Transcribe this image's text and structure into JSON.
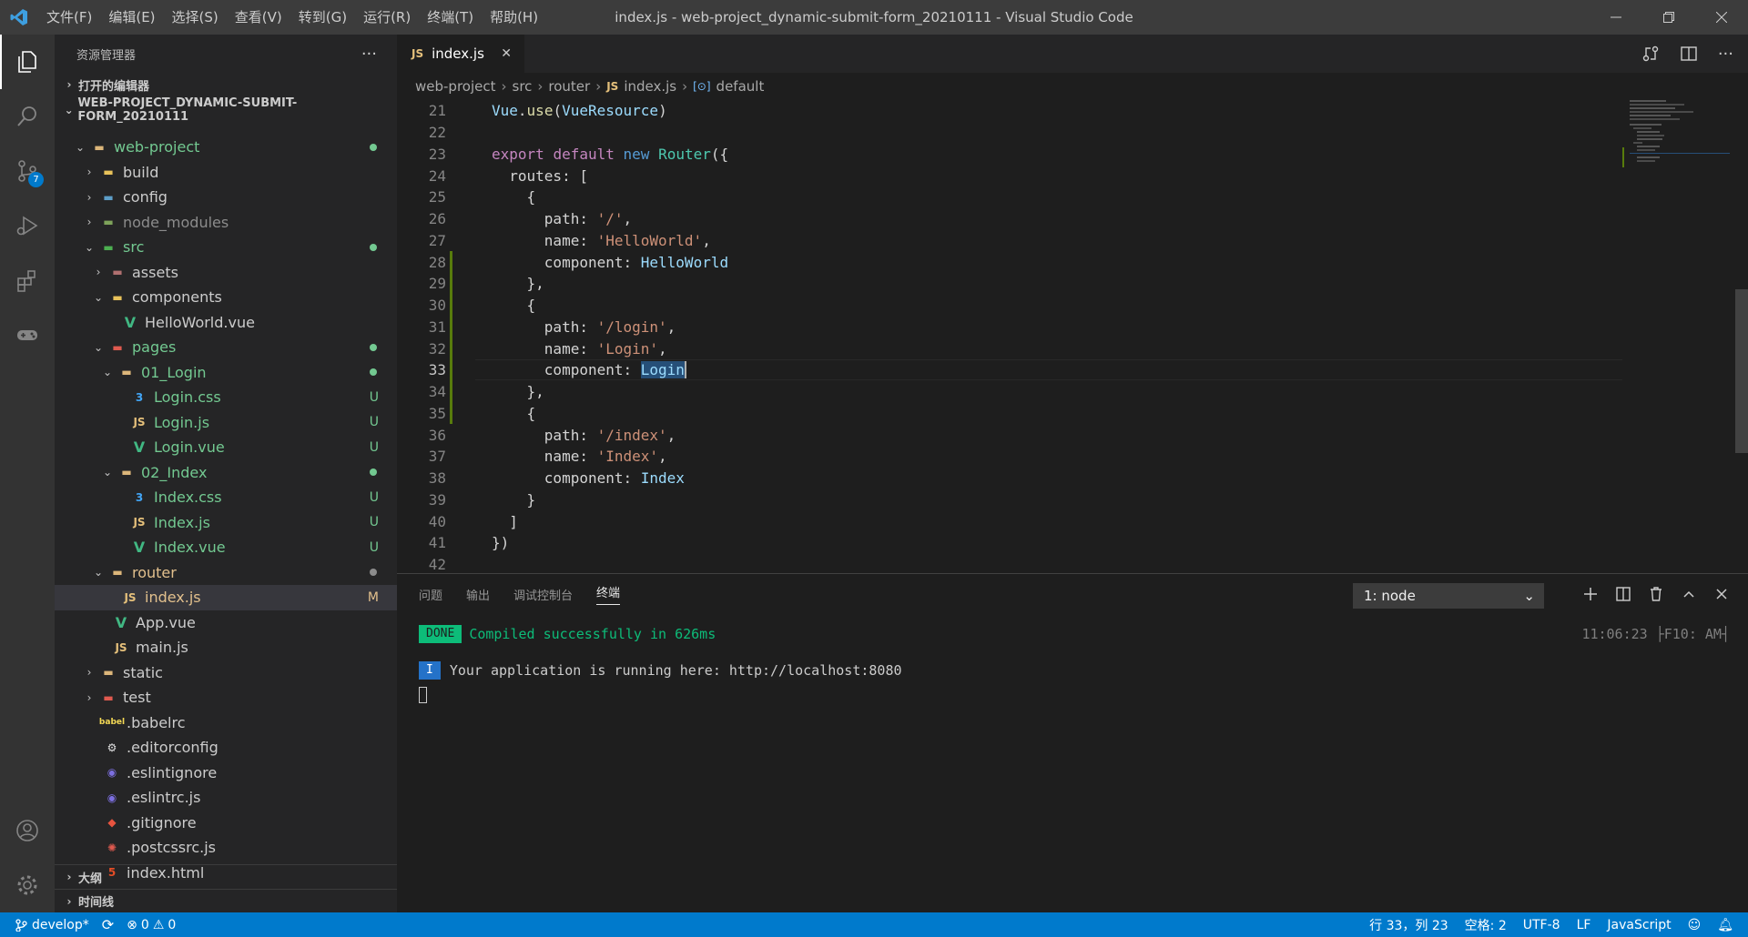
{
  "window": {
    "title": "index.js - web-project_dynamic-submit-form_20210111 - Visual Studio Code",
    "menu": [
      "文件(F)",
      "编辑(E)",
      "选择(S)",
      "查看(V)",
      "转到(G)",
      "运行(R)",
      "终端(T)",
      "帮助(H)"
    ]
  },
  "activity": {
    "scm_badge": "7"
  },
  "sidebar": {
    "header": "资源管理器",
    "open_editors": "打开的编辑器",
    "project": "WEB-PROJECT_DYNAMIC-SUBMIT-FORM_20210111",
    "tree": [
      {
        "label": "web-project",
        "decor": "dot"
      },
      {
        "label": "build"
      },
      {
        "label": "config"
      },
      {
        "label": "node_modules"
      },
      {
        "label": "src",
        "decor": "dot"
      },
      {
        "label": "assets"
      },
      {
        "label": "components"
      },
      {
        "label": "HelloWorld.vue"
      },
      {
        "label": "pages",
        "decor": "dot"
      },
      {
        "label": "01_Login",
        "decor": "dot"
      },
      {
        "label": "Login.css",
        "decor": "U"
      },
      {
        "label": "Login.js",
        "decor": "U"
      },
      {
        "label": "Login.vue",
        "decor": "U"
      },
      {
        "label": "02_Index",
        "decor": "dot"
      },
      {
        "label": "Index.css",
        "decor": "U"
      },
      {
        "label": "Index.js",
        "decor": "U"
      },
      {
        "label": "Index.vue",
        "decor": "U"
      },
      {
        "label": "router",
        "decor": "dot"
      },
      {
        "label": "index.js",
        "decor": "M"
      },
      {
        "label": "App.vue"
      },
      {
        "label": "main.js"
      },
      {
        "label": "static"
      },
      {
        "label": "test"
      },
      {
        "label": ".babelrc"
      },
      {
        "label": ".editorconfig"
      },
      {
        "label": ".eslintignore"
      },
      {
        "label": ".eslintrc.js"
      },
      {
        "label": ".gitignore"
      },
      {
        "label": ".postcssrc.js"
      },
      {
        "label": "index.html"
      }
    ],
    "outline": "大纲",
    "timeline": "时间线"
  },
  "editor": {
    "tab_label": "index.js",
    "tab_badge": "JS",
    "breadcrumb": [
      "web-project",
      "src",
      "router",
      "index.js",
      "default"
    ],
    "lines": [
      {
        "n": "21",
        "code": "Vue.use(VueResource)"
      },
      {
        "n": "22",
        "code": ""
      },
      {
        "n": "23",
        "code": "export default new Router({"
      },
      {
        "n": "24",
        "code": "  routes: ["
      },
      {
        "n": "25",
        "code": "    {"
      },
      {
        "n": "26",
        "code": "      path: '/',"
      },
      {
        "n": "27",
        "code": "      name: 'HelloWorld',"
      },
      {
        "n": "28",
        "code": "      component: HelloWorld"
      },
      {
        "n": "29",
        "code": "    },"
      },
      {
        "n": "30",
        "code": "    {"
      },
      {
        "n": "31",
        "code": "      path: '/login',"
      },
      {
        "n": "32",
        "code": "      name: 'Login',"
      },
      {
        "n": "33",
        "code": "      component: Login"
      },
      {
        "n": "34",
        "code": "    },"
      },
      {
        "n": "35",
        "code": "    {"
      },
      {
        "n": "36",
        "code": "      path: '/index',"
      },
      {
        "n": "37",
        "code": "      name: 'Index',"
      },
      {
        "n": "38",
        "code": "      component: Index"
      },
      {
        "n": "39",
        "code": "    }"
      },
      {
        "n": "40",
        "code": "  ]"
      },
      {
        "n": "41",
        "code": "})"
      },
      {
        "n": "42",
        "code": ""
      }
    ]
  },
  "panel": {
    "tabs": [
      "问题",
      "输出",
      "调试控制台",
      "终端"
    ],
    "terminal_select": "1: node",
    "done_badge": "DONE",
    "done_text": "Compiled successfully in 626ms",
    "time": "11:06:23 ├F10: AM┤",
    "info_badge": "I",
    "info_text": "Your application is running here: http://localhost:8080"
  },
  "status": {
    "branch": "develop*",
    "errors": "0",
    "warnings": "0",
    "position": "行 33，列 23",
    "spaces": "空格: 2",
    "encoding": "UTF-8",
    "eol": "LF",
    "language": "JavaScript"
  },
  "colors": {
    "accent": "#007acc",
    "untracked": "#73c991",
    "modified": "#e2c08d"
  }
}
